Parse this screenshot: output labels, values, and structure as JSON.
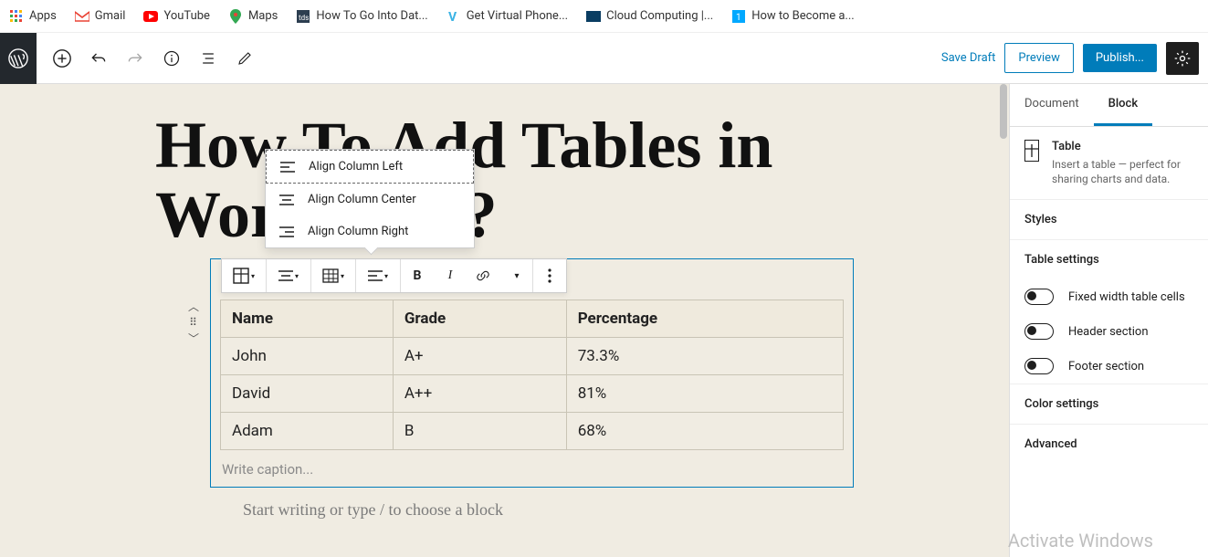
{
  "bookmarks": {
    "apps": "Apps",
    "gmail": "Gmail",
    "youtube": "YouTube",
    "maps": "Maps",
    "howto_data": "How To Go Into Dat...",
    "virtual_phone": "Get Virtual Phone...",
    "cloud": "Cloud Computing |...",
    "become": "How to Become a..."
  },
  "topbar": {
    "save_draft": "Save Draft",
    "preview": "Preview",
    "publish": "Publish..."
  },
  "post": {
    "title": "How To Add Tables in WordPress?",
    "caption_placeholder": "Write caption...",
    "slash_hint": "Start writing or type / to choose a block"
  },
  "dropdown": {
    "left": "Align Column Left",
    "center": "Align Column Center",
    "right": "Align Column Right"
  },
  "table": {
    "headers": [
      "Name",
      "Grade",
      "Percentage"
    ],
    "rows": [
      [
        "John",
        "A+",
        "73.3%"
      ],
      [
        "David",
        "A++",
        "81%"
      ],
      [
        "Adam",
        "B",
        "68%"
      ]
    ]
  },
  "sidebar": {
    "tabs": {
      "document": "Document",
      "block": "Block"
    },
    "block": {
      "name": "Table",
      "desc": "Insert a table — perfect for sharing charts and data."
    },
    "styles": "Styles",
    "table_settings": "Table settings",
    "toggles": {
      "fixed": "Fixed width table cells",
      "header": "Header section",
      "footer": "Footer section"
    },
    "color": "Color settings",
    "advanced": "Advanced"
  },
  "watermark": "Activate Windows"
}
